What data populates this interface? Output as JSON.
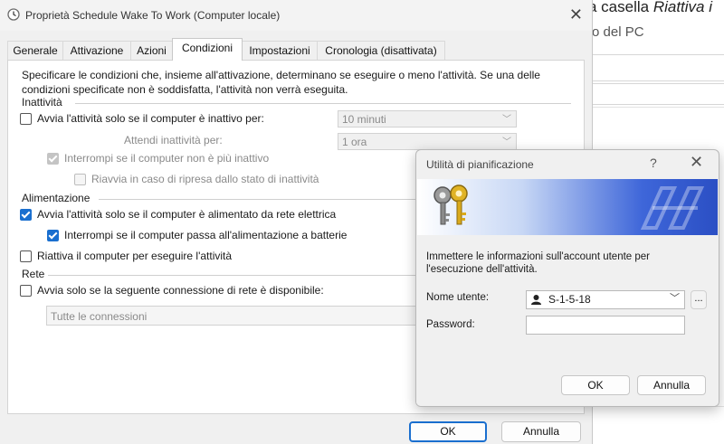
{
  "background": {
    "text_prefix": "a casella ",
    "text_italic": "Riattiva i",
    "text_line2": "o del PC"
  },
  "dialog": {
    "title": "Proprietà Schedule Wake To Work (Computer locale)",
    "tabs": [
      "Generale",
      "Attivazione",
      "Azioni",
      "Condizioni",
      "Impostazioni",
      "Cronologia (disattivata)"
    ],
    "active_tab": "Condizioni",
    "description": "Specificare le condizioni che, insieme all'attivazione, determinano se eseguire o meno l'attività. Se una delle condizioni specificate non è soddisfatta, l'attività non verrà eseguita.",
    "idle": {
      "group_label": "Inattività",
      "start_idle_label": "Avvia l'attività solo se il computer è inattivo per:",
      "start_idle_checked": false,
      "idle_duration": "10 minuti",
      "wait_label": "Attendi inattività per:",
      "wait_duration": "1 ora",
      "stop_label": "Interrompi se il computer non è più inattivo",
      "stop_checked": true,
      "restart_label": "Riavvia in caso di ripresa dallo stato di inattività",
      "restart_checked": false
    },
    "power": {
      "group_label": "Alimentazione",
      "ac_label": "Avvia l'attività solo se il computer è alimentato da rete elettrica",
      "ac_checked": true,
      "battery_label": "Interrompi se il computer passa all'alimentazione a batterie",
      "battery_checked": true,
      "wake_label": "Riattiva il computer per eseguire l'attività",
      "wake_checked": false
    },
    "network": {
      "group_label": "Rete",
      "connection_label": "Avvia solo se la seguente connessione di rete è disponibile:",
      "connection_checked": false,
      "connection_value": "Tutte le connessioni"
    },
    "ok_label": "OK",
    "cancel_label": "Annulla"
  },
  "popup": {
    "title": "Utilità di pianificazione",
    "help_glyph": "?",
    "close_glyph": "✕",
    "instructions": "Immettere le informazioni sull'account utente per l'esecuzione dell'attività.",
    "username_label": "Nome utente:",
    "username_value": "S-1-5-18",
    "browse_label": "...",
    "password_label": "Password:",
    "password_value": "",
    "ok_label": "OK",
    "cancel_label": "Annulla"
  },
  "colors": {
    "accent": "#1a6fcf",
    "banner_dark": "#2b4fc4"
  }
}
